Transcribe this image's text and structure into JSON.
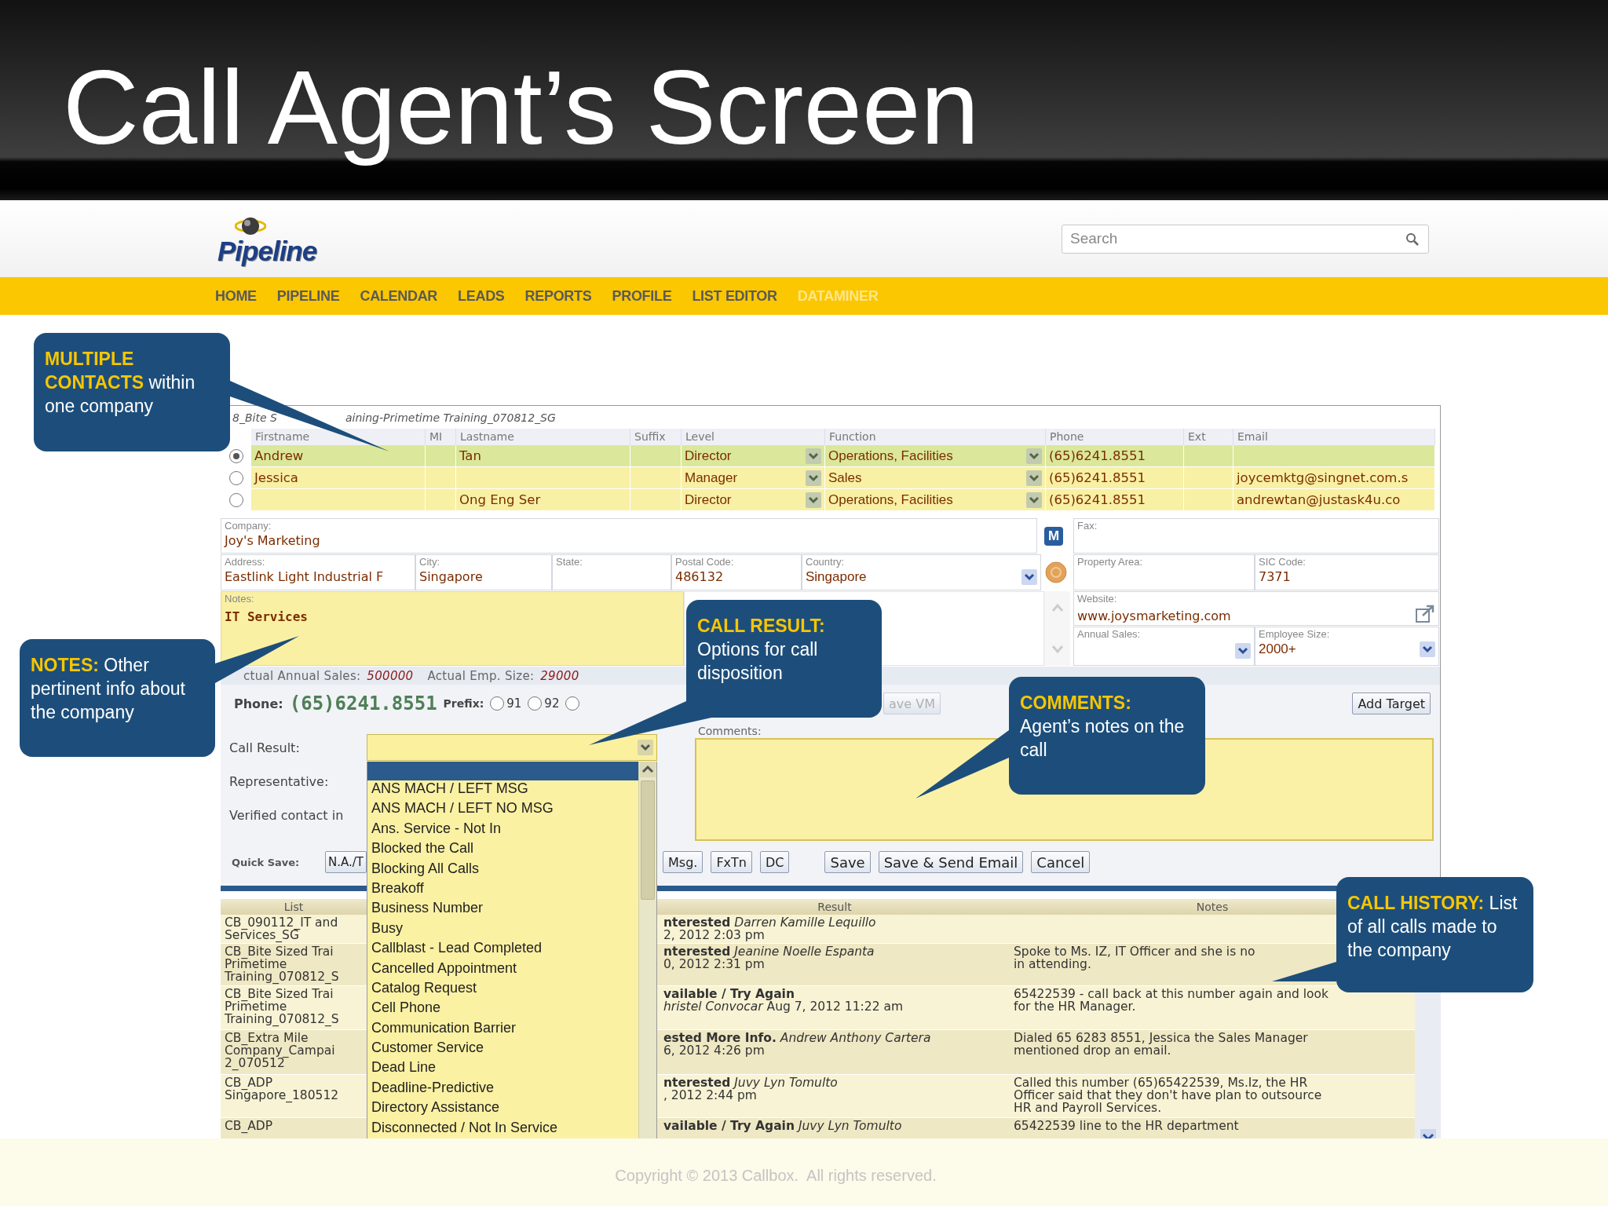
{
  "slide_title": "Call Agent’s Screen",
  "logo": {
    "name": "Pipeline"
  },
  "search": {
    "placeholder": "Search"
  },
  "nav": [
    {
      "label": "HOME",
      "selected": false
    },
    {
      "label": "PIPELINE",
      "selected": false
    },
    {
      "label": "CALENDAR",
      "selected": false
    },
    {
      "label": "LEADS",
      "selected": false
    },
    {
      "label": "REPORTS",
      "selected": false
    },
    {
      "label": "PROFILE",
      "selected": false
    },
    {
      "label": "LIST EDITOR",
      "selected": false
    },
    {
      "label": "DATAMINER",
      "selected": true
    }
  ],
  "breadcrumb": [
    "8_Bite S",
    "aining-Primetime Training_070812_SG"
  ],
  "contacts": {
    "columns": [
      "Firstname",
      "MI",
      "Lastname",
      "Suffix",
      "Level",
      "Function",
      "Phone",
      "Ext",
      "Email"
    ],
    "rows": [
      {
        "selected": true,
        "firstname": "Andrew",
        "lastname": "Tan",
        "level": "Director",
        "function": "Operations, Facilities",
        "phone": "(65)6241.8551"
      },
      {
        "selected": false,
        "firstname": "Jessica",
        "level": "Manager",
        "function": "Sales",
        "phone": "(65)6241.8551",
        "email": "joycemktg@singnet.com.s"
      },
      {
        "selected": false,
        "lastname": "Ong Eng Ser",
        "level": "Director",
        "function": "Operations, Facilities",
        "phone": "(65)6241.8551",
        "email": "andrewtan@justask4u.co"
      }
    ]
  },
  "company": {
    "company_label": "Company:",
    "company": "Joy's Marketing",
    "badge": "M",
    "address_label": "Address:",
    "address": "Eastlink Light Industrial F",
    "city_label": "City:",
    "city": "Singapore",
    "state_label": "State:",
    "postal_label": "Postal Code:",
    "postal": "486132",
    "country_label": "Country:",
    "country": "Singapore",
    "notes_label": "Notes:",
    "notes": "IT Services",
    "fax_label": "Fax:",
    "property_label": "Property Area:",
    "sic_label": "SIC Code:",
    "sic": "7371",
    "website_label": "Website:",
    "website": "www.joysmarketing.com",
    "annual_label": "Annual Sales:",
    "employee_label": "Employee Size:",
    "employee": "2000+"
  },
  "sales": {
    "annual_label": "ctual Annual Sales:",
    "annual_value": "500000",
    "emp_label": "Actual Emp. Size:",
    "emp_value": "29000"
  },
  "phone": {
    "label": "Phone:",
    "number": "(65)6241.8551",
    "prefix_label": "Prefix:",
    "prefixes": [
      {
        "label": "91",
        "selected": false
      },
      {
        "label": "92",
        "selected": false
      },
      {
        "selected": false
      }
    ],
    "buttons": [
      {
        "label": "ave VM",
        "disabled": true
      },
      {
        "label": "Add Target",
        "disabled": false
      }
    ]
  },
  "call": {
    "result_label": "Call Result:",
    "representative_label": "Representative:",
    "verified_label": "Verified contact in",
    "comments_label": "Comments:",
    "quick_save_label": "Quick Save:",
    "quick_buttons": [
      "N.A./T",
      "Msg.",
      "FxTn",
      "DC"
    ],
    "actions": [
      "Save",
      "Save & Send Email",
      "Cancel"
    ]
  },
  "result_dropdown": {
    "blank_selected": true,
    "options": [
      {
        "label": "ANS MACH / LEFT MSG",
        "selected": false
      },
      {
        "label": "ANS MACH / LEFT NO MSG",
        "selected": false
      },
      {
        "label": "Ans. Service - Not In",
        "selected": false
      },
      {
        "label": "Blocked the Call",
        "selected": false
      },
      {
        "label": "Blocking All Calls",
        "selected": false
      },
      {
        "label": "Breakoff",
        "selected": false
      },
      {
        "label": "Business Number",
        "selected": false
      },
      {
        "label": "Busy",
        "selected": false
      },
      {
        "label": "Callblast - Lead Completed",
        "selected": false
      },
      {
        "label": "Cancelled Appointment",
        "selected": false
      },
      {
        "label": "Catalog Request",
        "selected": false
      },
      {
        "label": "Cell Phone",
        "selected": false
      },
      {
        "label": "Communication Barrier",
        "selected": false
      },
      {
        "label": "Customer Service",
        "selected": false
      },
      {
        "label": "Dead Line",
        "selected": false
      },
      {
        "label": "Deadline-Predictive",
        "selected": false
      },
      {
        "label": "Directory Assistance",
        "selected": false
      },
      {
        "label": "Disconnected / Not In Service",
        "selected": false
      }
    ]
  },
  "history": {
    "columns": [
      "List",
      "Result",
      "Notes"
    ],
    "rows": [
      {
        "list": [
          "CB_090112_IT and",
          "Services_SG"
        ],
        "result": [
          "**nterested** *Darren Kamille Lequillo*",
          "2, 2012 2:03 pm"
        ]
      },
      {
        "list": [
          "CB_Bite Sized Trai",
          "Primetime",
          "Training_070812_S"
        ],
        "result": [
          "**nterested** *Jeanine Noelle Espanta*",
          "0, 2012 2:31 pm"
        ],
        "notes": [
          "Spoke to Ms. IZ, IT Officer and she is no",
          "in attending."
        ]
      },
      {
        "list": [
          "CB_Bite Sized Trai",
          "Primetime",
          "Training_070812_S"
        ],
        "result": [
          "**vailable / Try Again**",
          "*hristel Convocar* Aug 7, 2012 11:22 am"
        ],
        "notes": [
          "65422539 - call back at this number again and look",
          "for the HR Manager."
        ]
      },
      {
        "list": [
          "CB_Extra Mile",
          "Company_Campai",
          "2_070512"
        ],
        "result": [
          "**ested More Info.** *Andrew Anthony Cartera*",
          "6, 2012 4:26 pm"
        ],
        "notes": [
          "Dialed 65 6283 8551, Jessica the Sales Manager",
          "mentioned drop an email."
        ]
      },
      {
        "list": [
          "CB_ADP",
          "Singapore_180512"
        ],
        "result": [
          "**nterested** *Juvy Lyn Tomulto*",
          ", 2012 2:44 pm"
        ],
        "notes": [
          "Called this number (65)65422539, Ms.Iz, the HR",
          "Officer said that they don't have plan to outsource",
          "HR and Payroll Services."
        ]
      },
      {
        "list": [
          "CB_ADP"
        ],
        "result": [
          "**vailable / Try Again** *Juvy Lyn Tomulto*"
        ],
        "notes": [
          "65422539 line to the HR department"
        ]
      }
    ]
  },
  "callouts": [
    {
      "heading": "MULTIPLE CONTACTS",
      "body": "within one company"
    },
    {
      "heading": "NOTES:",
      "body": "Other pertinent info about the company"
    },
    {
      "heading": "CALL RESULT:",
      "body": "Options for call disposition"
    },
    {
      "heading": "COMMENTS:",
      "body": "Agent’s notes on the call"
    },
    {
      "heading": "CALL HISTORY:",
      "body": "List of all calls made to the company"
    }
  ],
  "footer": "Copyright © 2013 Callbox.  All rights reserved."
}
